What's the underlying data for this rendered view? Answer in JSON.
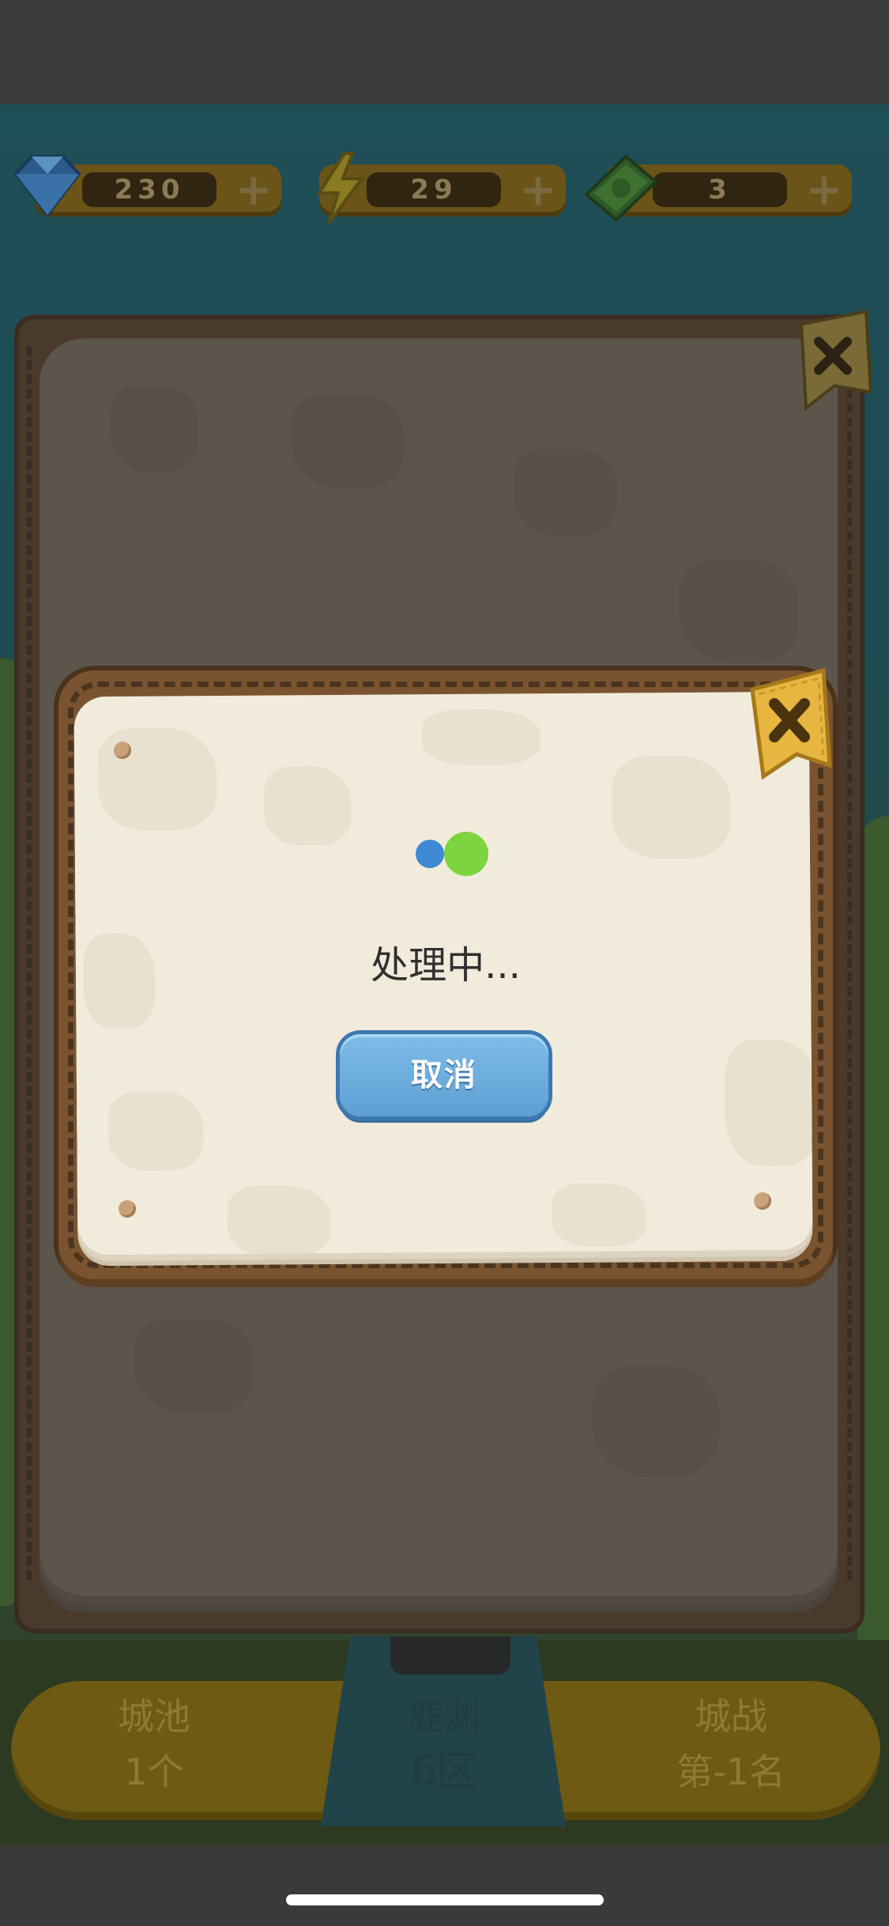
{
  "resources": [
    {
      "name": "diamonds",
      "value": "230",
      "icon": "diamond-icon"
    },
    {
      "name": "energy",
      "value": "29",
      "icon": "lightning-icon"
    },
    {
      "name": "cash",
      "value": "3",
      "icon": "cash-icon"
    }
  ],
  "plus_symbol": "+",
  "dialog": {
    "status_text": "处理中...",
    "cancel_label": "取消",
    "close_icon": "close-icon"
  },
  "bottom_bar": {
    "left": {
      "line1": "城池",
      "line2": "1个"
    },
    "center": {
      "line1": "鹿渊",
      "line2": "6区"
    },
    "right": {
      "line1": "城战",
      "line2": "第-1名"
    }
  },
  "colors": {
    "loader_blue": "#3e8ad4",
    "loader_green": "#7cd43e",
    "button_blue": "#6aaee0"
  }
}
